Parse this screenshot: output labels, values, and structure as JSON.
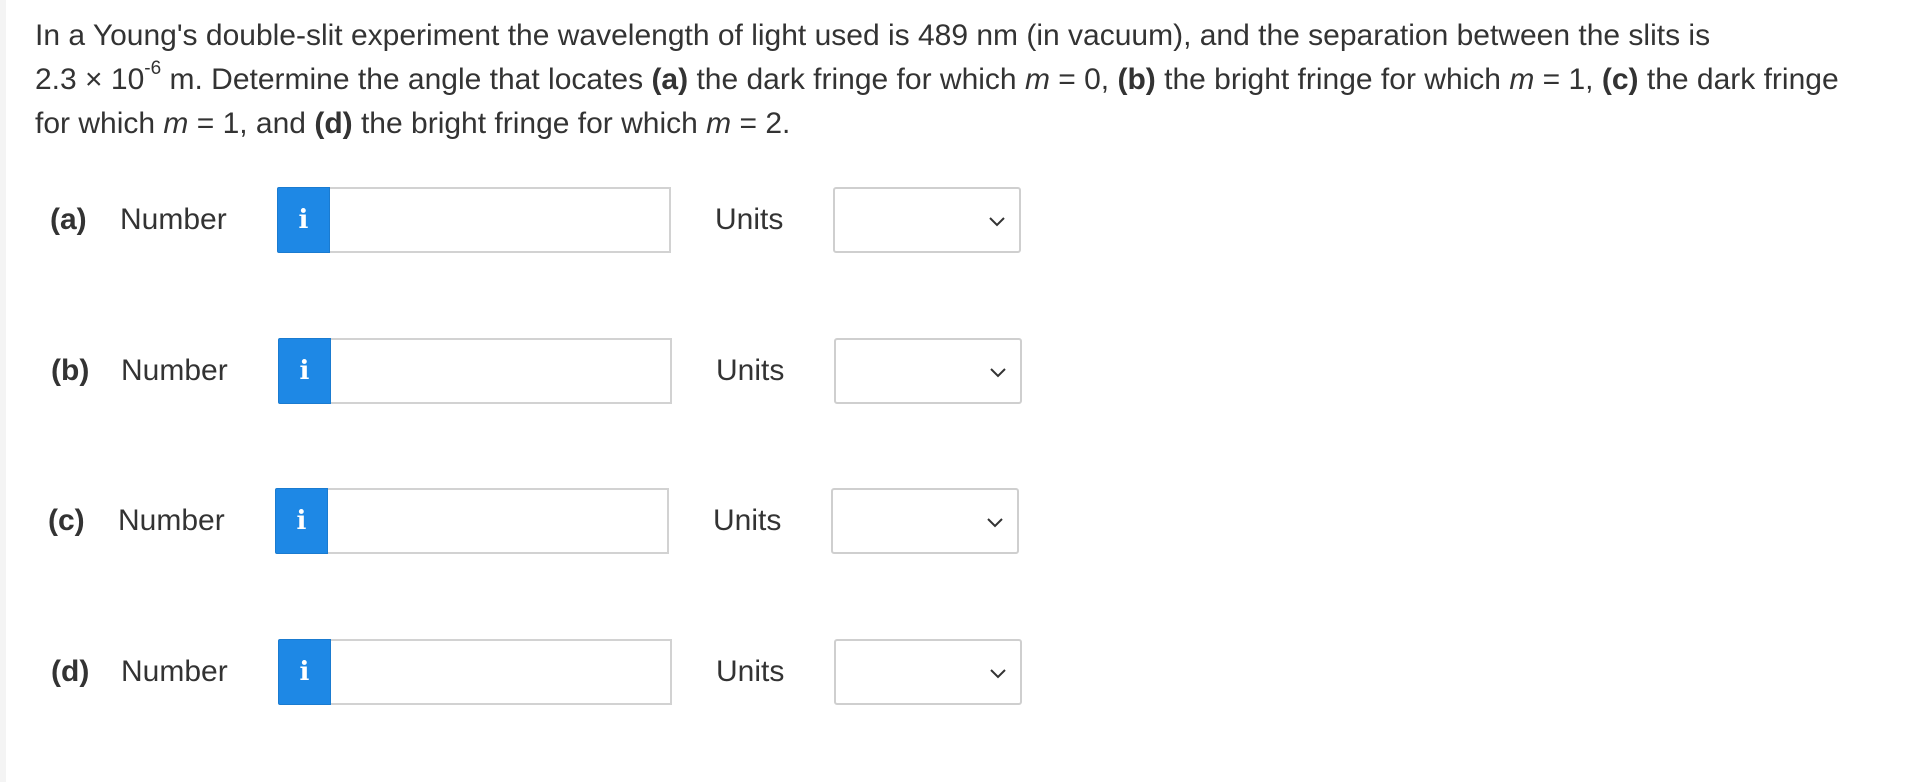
{
  "question": {
    "p1": "In a Young's double-slit experiment the wavelength of light used is 489 nm (in vacuum), and the separation between the slits is",
    "p2": "2.3 × 10",
    "exp": "-6",
    "p3": " m. Determine the angle that locates ",
    "a_tag": "(a)",
    "p4": " the dark fringe for which ",
    "m1": "m",
    "p5": " = 0, ",
    "b_tag": "(b)",
    "p6": " the bright fringe for which ",
    "m2": "m",
    "p7": " = 1, ",
    "c_tag": "(c)",
    "p8": " the dark fringe for which ",
    "m3": "m",
    "p9": " = 1, and ",
    "d_tag": "(d)",
    "p10": " the bright fringe for which ",
    "m4": "m",
    "p11": " = 2."
  },
  "parts": [
    {
      "tag": "(a)",
      "number_label": "Number",
      "info_icon": "i",
      "number_value": "",
      "units_label": "Units",
      "units_value": ""
    },
    {
      "tag": "(b)",
      "number_label": "Number",
      "info_icon": "i",
      "number_value": "",
      "units_label": "Units",
      "units_value": ""
    },
    {
      "tag": "(c)",
      "number_label": "Number",
      "info_icon": "i",
      "number_value": "",
      "units_label": "Units",
      "units_value": ""
    },
    {
      "tag": "(d)",
      "number_label": "Number",
      "info_icon": "i",
      "number_value": "",
      "units_label": "Units",
      "units_value": ""
    }
  ],
  "colors": {
    "info_button": "#1e88e5",
    "text": "#333333",
    "input_border": "#d2d2d2"
  },
  "icons": {
    "info": "info-icon",
    "dropdown": "chevron-down-icon"
  }
}
